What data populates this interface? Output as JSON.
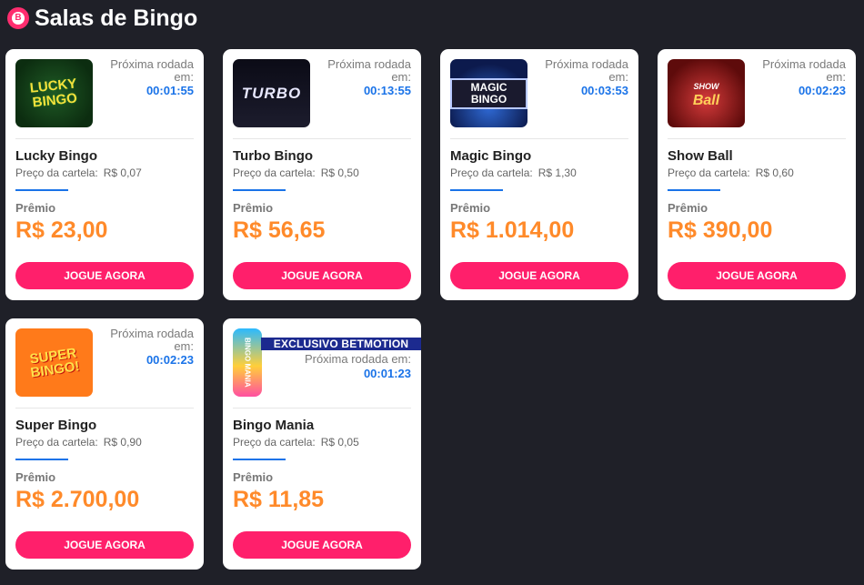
{
  "header": {
    "title": "Salas de Bingo",
    "icon_glyph": "B"
  },
  "labels": {
    "next_round": "Próxima rodada em:",
    "card_price": "Preço da cartela:",
    "prize": "Prêmio",
    "play": "JOGUE AGORA",
    "exclusive": "EXCLUSIVO BETMOTION"
  },
  "rooms": [
    {
      "name": "Lucky Bingo",
      "time": "00:01:55",
      "price": "R$ 0,07",
      "prize": "R$ 23,00",
      "logo_text": "LUCKY BINGO"
    },
    {
      "name": "Turbo Bingo",
      "time": "00:13:55",
      "price": "R$ 0,50",
      "prize": "R$ 56,65",
      "logo_text": "TURBO"
    },
    {
      "name": "Magic Bingo",
      "time": "00:03:53",
      "price": "R$ 1,30",
      "prize": "R$ 1.014,00",
      "logo_text": "MAGIC BINGO"
    },
    {
      "name": "Show Ball",
      "time": "00:02:23",
      "price": "R$ 0,60",
      "prize": "R$ 390,00",
      "logo_text": "Ball",
      "logo_small": "SHOW"
    },
    {
      "name": "Super Bingo",
      "time": "00:02:23",
      "price": "R$ 0,90",
      "prize": "R$ 2.700,00",
      "logo_text": "SUPER BINGO!"
    },
    {
      "name": "Bingo Mania",
      "time": "00:01:23",
      "price": "R$ 0,05",
      "prize": "R$ 11,85",
      "logo_text": "BINGO MANIA"
    }
  ],
  "colors": {
    "background": "#1f2028",
    "accent_pink": "#ff1f6b",
    "time_blue": "#1a73e8",
    "prize_orange": "#ff8a2a",
    "exclusive_banner": "#1c2a8f"
  }
}
